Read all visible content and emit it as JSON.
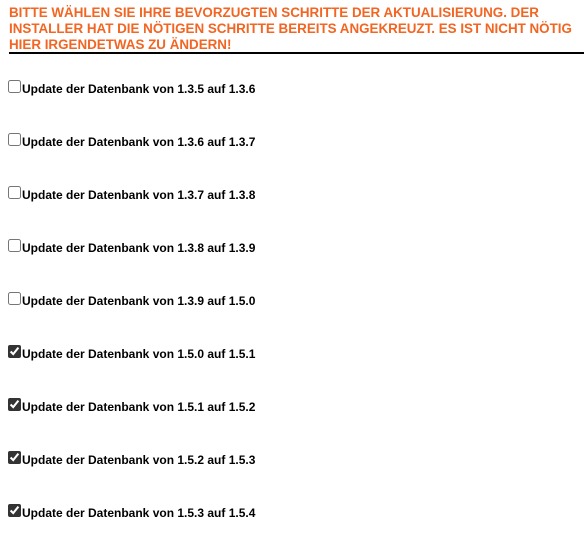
{
  "instructions": "BITTE WÄHLEN SIE IHRE BEVORZUGTEN SCHRITTE DER AKTUALISIERUNG. DER INSTALLER HAT DIE NÖTIGEN SCHRITTE BEREITS ANGEKREUZT. ES IST NICHT NÖTIG HIER IRGENDETWAS ZU ÄNDERN!",
  "steps": [
    {
      "label": "Update der Datenbank von 1.3.5 auf 1.3.6",
      "checked": false
    },
    {
      "label": "Update der Datenbank von 1.3.6 auf 1.3.7",
      "checked": false
    },
    {
      "label": "Update der Datenbank von 1.3.7 auf 1.3.8",
      "checked": false
    },
    {
      "label": "Update der Datenbank von 1.3.8 auf 1.3.9",
      "checked": false
    },
    {
      "label": "Update der Datenbank von 1.3.9 auf 1.5.0",
      "checked": false
    },
    {
      "label": "Update der Datenbank von 1.5.0 auf 1.5.1",
      "checked": true
    },
    {
      "label": "Update der Datenbank von 1.5.1 auf 1.5.2",
      "checked": true
    },
    {
      "label": "Update der Datenbank von 1.5.2 auf 1.5.3",
      "checked": true
    },
    {
      "label": "Update der Datenbank von 1.5.3 auf 1.5.4",
      "checked": true
    }
  ],
  "colors": {
    "heading": "#f26522",
    "rule": "#000000"
  }
}
